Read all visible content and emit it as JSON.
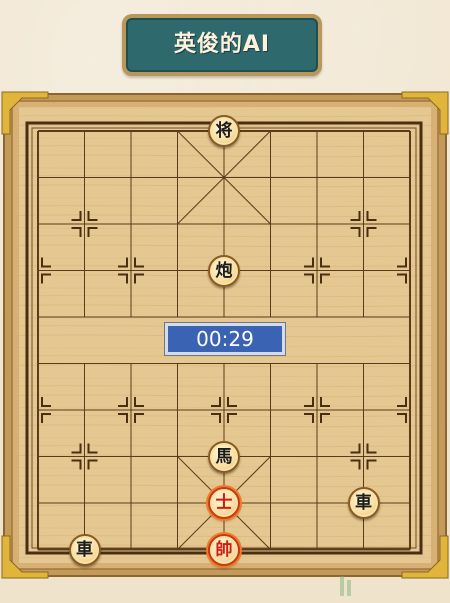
{
  "title": "英俊的AI",
  "timer": "00:29",
  "watermark": "",
  "colors": {
    "board": "#e3c48e",
    "frame": "#b58a4c",
    "line": "#5b3b1c",
    "banner": "#2e6a6d",
    "timer_bg": "#3b63b3",
    "red_piece_text": "#cc1d10",
    "black_piece_text": "#1b1b1b"
  },
  "pieces": [
    {
      "label": "将",
      "side": "black",
      "file": 4,
      "rank": 0
    },
    {
      "label": "炮",
      "side": "black",
      "file": 4,
      "rank": 3
    },
    {
      "label": "馬",
      "side": "black",
      "file": 4,
      "rank": 7
    },
    {
      "label": "車",
      "side": "black",
      "file": 7,
      "rank": 8
    },
    {
      "label": "車",
      "side": "black",
      "file": 1,
      "rank": 9
    },
    {
      "label": "士",
      "side": "red",
      "file": 4,
      "rank": 8
    },
    {
      "label": "帥",
      "side": "red",
      "file": 4,
      "rank": 9
    }
  ]
}
